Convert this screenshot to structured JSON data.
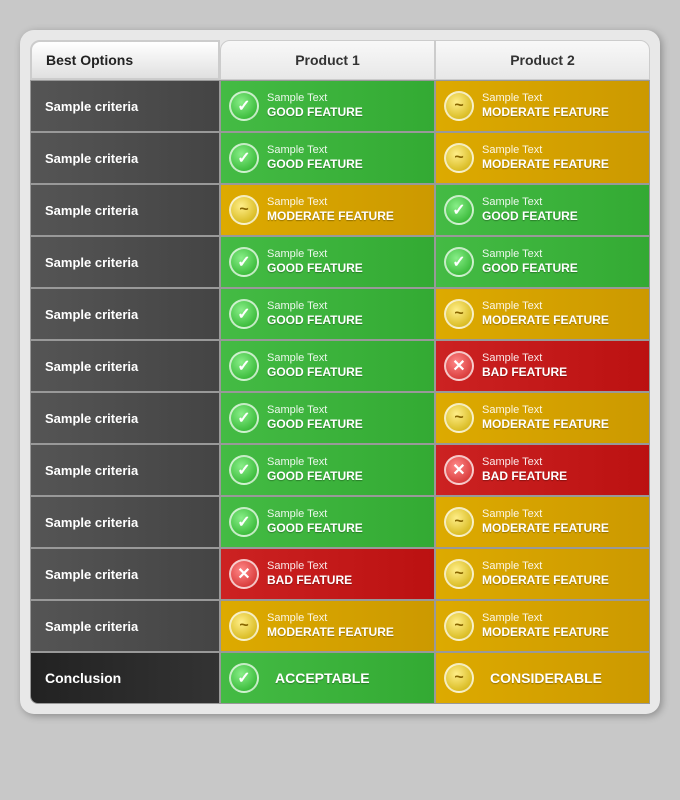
{
  "header": {
    "col1": "Best Options",
    "col2": "Product 1",
    "col3": "Product 2"
  },
  "rows": [
    {
      "criteria": "Sample criteria",
      "p1": {
        "type": "good",
        "sample": "Sample Text",
        "label": "GOOD FEATURE"
      },
      "p2": {
        "type": "moderate",
        "sample": "Sample Text",
        "label": "MODERATE FEATURE"
      }
    },
    {
      "criteria": "Sample criteria",
      "p1": {
        "type": "good",
        "sample": "Sample Text",
        "label": "GOOD FEATURE"
      },
      "p2": {
        "type": "moderate",
        "sample": "Sample Text",
        "label": "MODERATE FEATURE"
      }
    },
    {
      "criteria": "Sample criteria",
      "p1": {
        "type": "moderate",
        "sample": "Sample Text",
        "label": "MODERATE FEATURE"
      },
      "p2": {
        "type": "good",
        "sample": "Sample Text",
        "label": "GOOD FEATURE"
      }
    },
    {
      "criteria": "Sample criteria",
      "p1": {
        "type": "good",
        "sample": "Sample Text",
        "label": "GOOD FEATURE"
      },
      "p2": {
        "type": "good",
        "sample": "Sample Text",
        "label": "GOOD FEATURE"
      }
    },
    {
      "criteria": "Sample criteria",
      "p1": {
        "type": "good",
        "sample": "Sample Text",
        "label": "GOOD FEATURE"
      },
      "p2": {
        "type": "moderate",
        "sample": "Sample Text",
        "label": "MODERATE FEATURE"
      }
    },
    {
      "criteria": "Sample criteria",
      "p1": {
        "type": "good",
        "sample": "Sample Text",
        "label": "GOOD FEATURE"
      },
      "p2": {
        "type": "bad",
        "sample": "Sample Text",
        "label": "BAD FEATURE"
      }
    },
    {
      "criteria": "Sample criteria",
      "p1": {
        "type": "good",
        "sample": "Sample Text",
        "label": "GOOD FEATURE"
      },
      "p2": {
        "type": "moderate",
        "sample": "Sample Text",
        "label": "MODERATE FEATURE"
      }
    },
    {
      "criteria": "Sample criteria",
      "p1": {
        "type": "good",
        "sample": "Sample Text",
        "label": "GOOD FEATURE"
      },
      "p2": {
        "type": "bad",
        "sample": "Sample Text",
        "label": "BAD FEATURE"
      }
    },
    {
      "criteria": "Sample criteria",
      "p1": {
        "type": "good",
        "sample": "Sample Text",
        "label": "GOOD FEATURE"
      },
      "p2": {
        "type": "moderate",
        "sample": "Sample Text",
        "label": "MODERATE FEATURE"
      }
    },
    {
      "criteria": "Sample criteria",
      "p1": {
        "type": "bad",
        "sample": "Sample Text",
        "label": "BAD FEATURE"
      },
      "p2": {
        "type": "moderate",
        "sample": "Sample Text",
        "label": "MODERATE FEATURE"
      }
    },
    {
      "criteria": "Sample criteria",
      "p1": {
        "type": "moderate",
        "sample": "Sample Text",
        "label": "MODERATE FEATURE"
      },
      "p2": {
        "type": "moderate",
        "sample": "Sample Text",
        "label": "MODERATE FEATURE"
      }
    }
  ],
  "conclusion": {
    "label": "Conclusion",
    "p1": {
      "type": "good",
      "label": "ACCEPTABLE"
    },
    "p2": {
      "type": "moderate",
      "label": "CONSIDERABLE"
    }
  },
  "icons": {
    "good": "✓",
    "moderate": "~",
    "bad": "✕"
  }
}
